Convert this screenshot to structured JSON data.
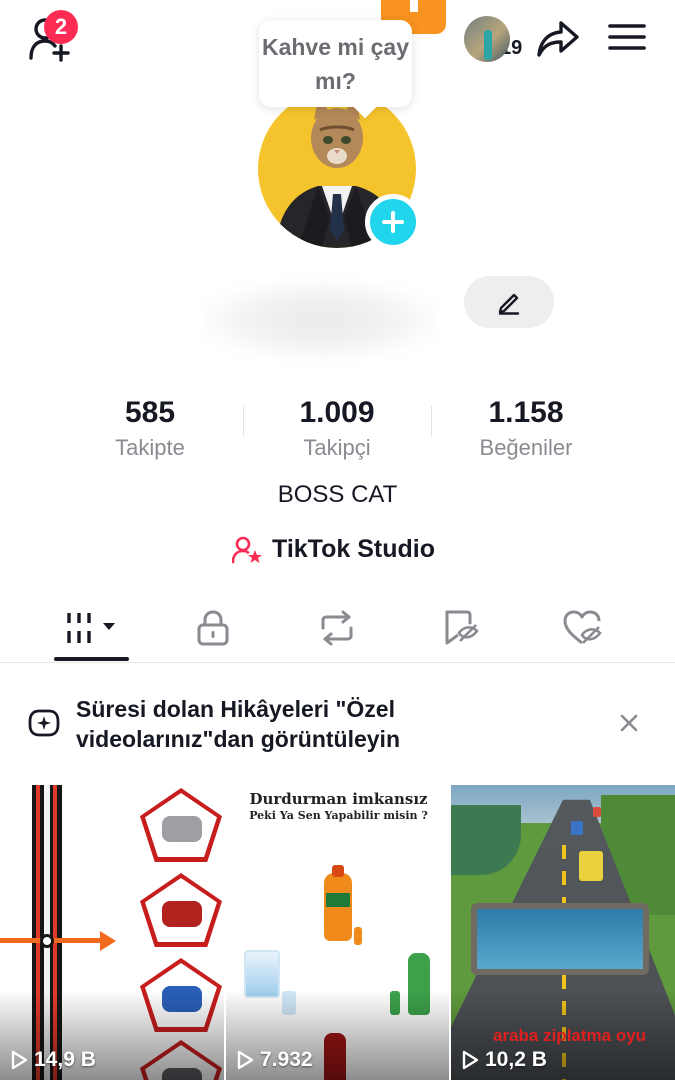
{
  "top_bar": {
    "notification_count": "2",
    "friend_count": "19"
  },
  "bubble": {
    "text": "Kahve mi çay mı?"
  },
  "stats": [
    {
      "value": "585",
      "label": "Takipte"
    },
    {
      "value": "1.009",
      "label": "Takipçi"
    },
    {
      "value": "1.158",
      "label": "Beğeniler"
    }
  ],
  "bio": "BOSS CAT",
  "studio": {
    "label": "TikTok Studio"
  },
  "tabs": [
    "videos-icon",
    "lock-icon",
    "repost-icon",
    "favorites-icon",
    "liked-icon"
  ],
  "banner": {
    "text": "Süresi dolan Hikâyeleri \"Özel videolarınız\"dan görüntüleyin"
  },
  "videos": [
    {
      "views": "14,9 B"
    },
    {
      "views": "7.932",
      "title": "Durdurman imkansız",
      "subtitle": "Peki Ya Sen Yapabilir misin ?"
    },
    {
      "views": "10,2 B",
      "caption": "araba ziplatma oyu"
    }
  ],
  "colors": {
    "accent": "#fe2c55",
    "cyan": "#20d5ec",
    "orange": "#f7931e",
    "avatar_bg": "#f5c42c"
  }
}
